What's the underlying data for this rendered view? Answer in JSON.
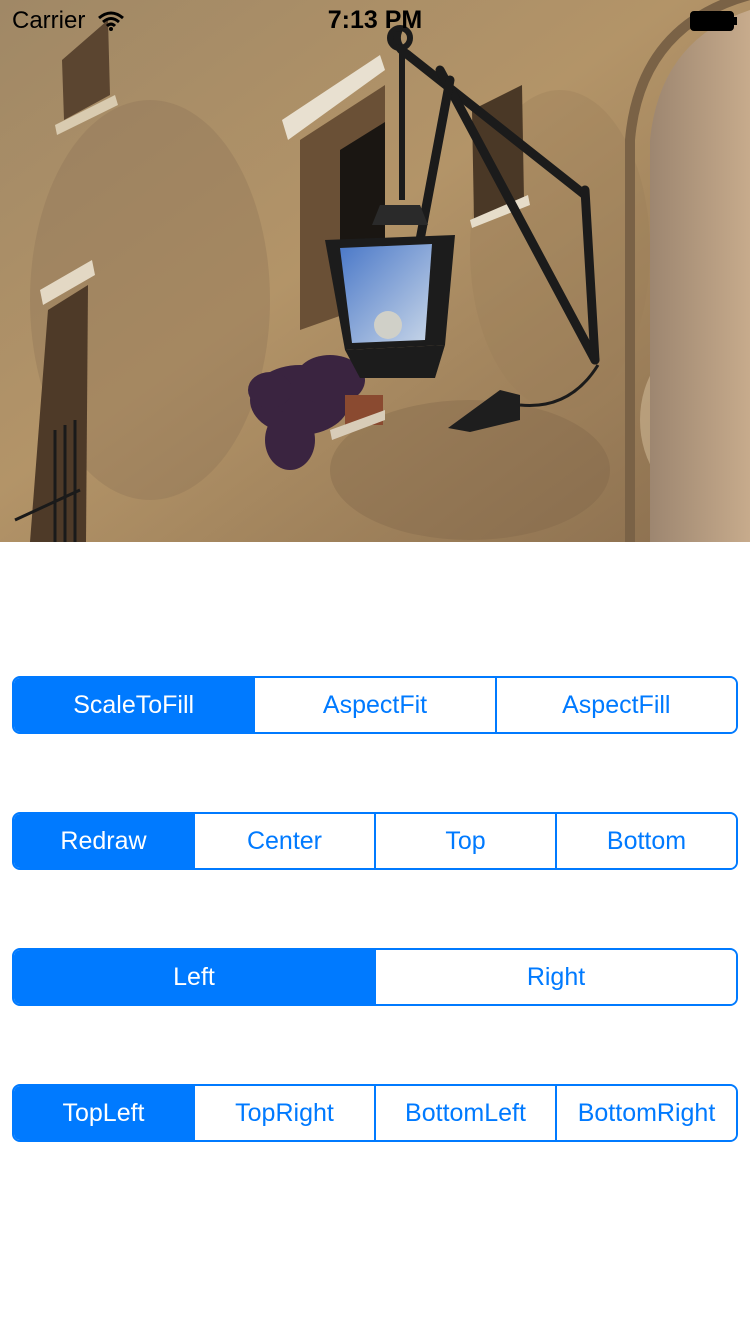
{
  "status_bar": {
    "carrier": "Carrier",
    "time": "7:13 PM",
    "wifi_icon": "wifi-icon",
    "battery_icon": "battery-icon"
  },
  "photo": {
    "subject": "wall-lantern-photo"
  },
  "content_mode_control": {
    "segments": [
      "ScaleToFill",
      "AspectFit",
      "AspectFill"
    ],
    "selected_index": 0
  },
  "redraw_control": {
    "segments": [
      "Redraw",
      "Center",
      "Top",
      "Bottom"
    ],
    "selected_index": 0
  },
  "horizontal_control": {
    "segments": [
      "Left",
      "Right"
    ],
    "selected_index": 0
  },
  "corner_control": {
    "segments": [
      "TopLeft",
      "TopRight",
      "BottomLeft",
      "BottomRight"
    ],
    "selected_index": 0
  },
  "colors": {
    "tint": "#007aff",
    "background": "#ffffff"
  }
}
